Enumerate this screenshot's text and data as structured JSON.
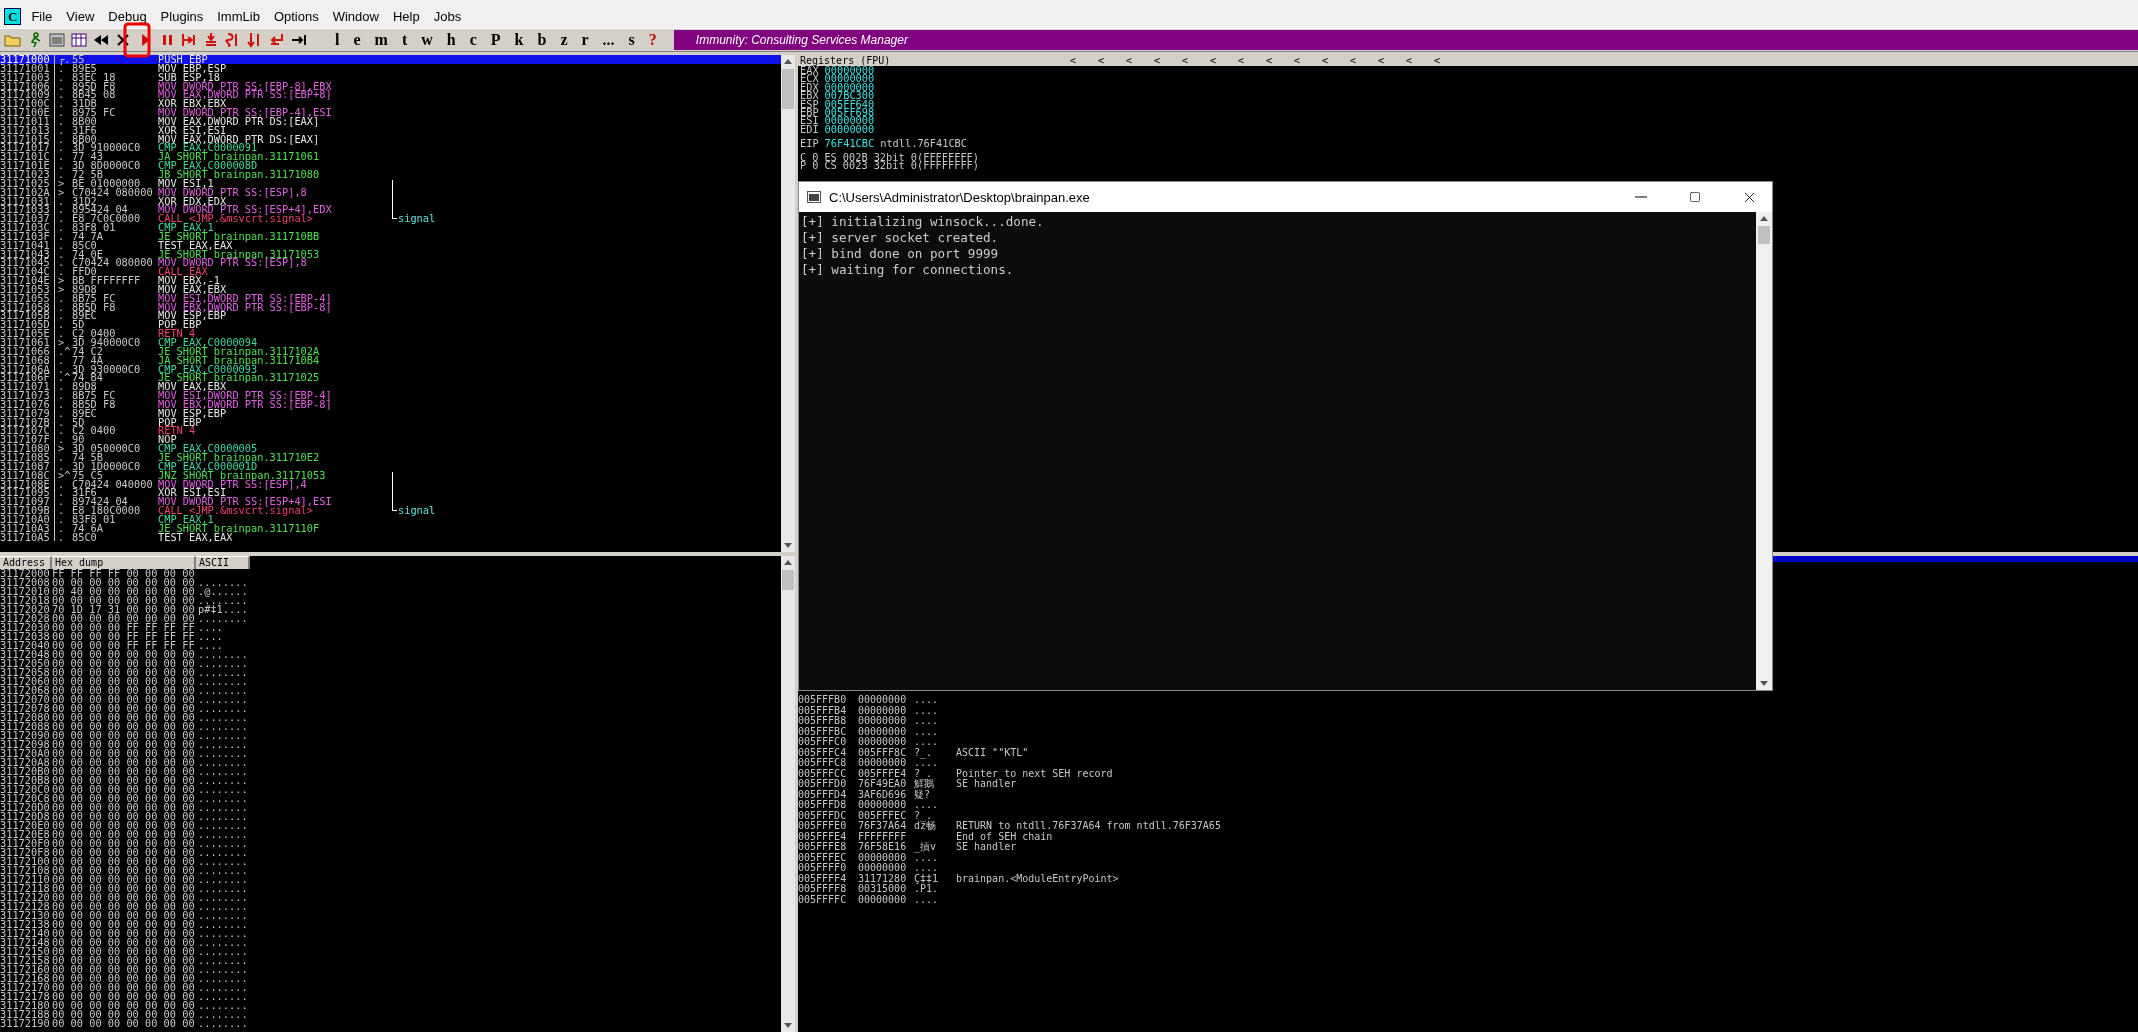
{
  "menu": {
    "app_icon": "C",
    "items": [
      "File",
      "View",
      "Debug",
      "Plugins",
      "ImmLib",
      "Options",
      "Window",
      "Help",
      "Jobs"
    ]
  },
  "toolbar": {
    "buttons": [
      {
        "label": "l",
        "kind": "window"
      },
      {
        "label": "e",
        "kind": "window"
      },
      {
        "label": "m",
        "kind": "window"
      },
      {
        "label": "t",
        "kind": "window"
      },
      {
        "label": "w",
        "kind": "window"
      },
      {
        "label": "h",
        "kind": "window"
      },
      {
        "label": "c",
        "kind": "window"
      },
      {
        "label": "P",
        "kind": "window"
      },
      {
        "label": "k",
        "kind": "window"
      },
      {
        "label": "b",
        "kind": "window"
      },
      {
        "label": "z",
        "kind": "window"
      },
      {
        "label": "r",
        "kind": "window"
      },
      {
        "label": "...",
        "kind": "window"
      },
      {
        "label": "s",
        "kind": "window"
      },
      {
        "label": "?",
        "kind": "help"
      }
    ],
    "banner": "Immunity: Consulting Services Manager"
  },
  "disassembly": [
    {
      "address": "31171000",
      "mark": "┌.",
      "hex": "55",
      "instruction": "PUSH EBP",
      "kind": "plain",
      "selected": true
    },
    {
      "address": "31171001",
      "mark": ".",
      "hex": "89E5",
      "instruction": "MOV EBP,ESP",
      "kind": "plain",
      "selected": false
    },
    {
      "address": "31171003",
      "mark": ".",
      "hex": "83EC 18",
      "instruction": "SUB ESP,18",
      "kind": "plain",
      "selected": false
    },
    {
      "address": "31171006",
      "mark": ".",
      "hex": "895D F8",
      "instruction": "MOV DWORD PTR SS:[EBP-8],EBX",
      "kind": "mem",
      "selected": false
    },
    {
      "address": "31171009",
      "mark": ".",
      "hex": "8B45 08",
      "instruction": "MOV EAX,DWORD PTR SS:[EBP+8]",
      "kind": "mem",
      "selected": false
    },
    {
      "address": "3117100C",
      "mark": ".",
      "hex": "31DB",
      "instruction": "XOR EBX,EBX",
      "kind": "plain",
      "selected": false
    },
    {
      "address": "3117100E",
      "mark": ".",
      "hex": "8975 FC",
      "instruction": "MOV DWORD PTR SS:[EBP-4],ESI",
      "kind": "mem",
      "selected": false
    },
    {
      "address": "31171011",
      "mark": ".",
      "hex": "8B00",
      "instruction": "MOV EAX,DWORD PTR DS:[EAX]",
      "kind": "plain",
      "selected": false
    },
    {
      "address": "31171013",
      "mark": ".",
      "hex": "31F6",
      "instruction": "XOR ESI,ESI",
      "kind": "plain",
      "selected": false
    },
    {
      "address": "31171015",
      "mark": ".",
      "hex": "8B00",
      "instruction": "MOV EAX,DWORD PTR DS:[EAX]",
      "kind": "plain",
      "selected": false
    },
    {
      "address": "31171017",
      "mark": ".",
      "hex": "3D 910000C0",
      "instruction": "CMP EAX,C0000091",
      "kind": "cmp",
      "selected": false
    },
    {
      "address": "3117101C",
      "mark": ".",
      "hex": "77 43",
      "instruction": "JA SHORT brainpan.31171061",
      "kind": "jump",
      "selected": false
    },
    {
      "address": "3117101E",
      "mark": ".",
      "hex": "3D 8D0000C0",
      "instruction": "CMP EAX,C000008D",
      "kind": "cmp",
      "selected": false
    },
    {
      "address": "31171023",
      "mark": ".",
      "hex": "72 5B",
      "instruction": "JB SHORT brainpan.31171080",
      "kind": "jump",
      "selected": false
    },
    {
      "address": "31171025",
      "mark": ">",
      "hex": "BE 01000000",
      "instruction": "MOV ESI,1",
      "kind": "plain",
      "selected": false
    },
    {
      "address": "3117102A",
      "mark": ">",
      "hex": "C70424 080000",
      "instruction": "MOV DWORD PTR SS:[ESP],8",
      "kind": "mem",
      "selected": false
    },
    {
      "address": "31171031",
      "mark": ".",
      "hex": "31D2",
      "instruction": "XOR EDX,EDX",
      "kind": "plain",
      "selected": false
    },
    {
      "address": "31171033",
      "mark": ".",
      "hex": "895424 04",
      "instruction": "MOV DWORD PTR SS:[ESP+4],EDX",
      "kind": "mem",
      "selected": false
    },
    {
      "address": "31171037",
      "mark": ".",
      "hex": "E8 7C0C0000",
      "instruction": "CALL <JMP.&msvcrt.signal>",
      "kind": "call",
      "comment": "signal",
      "selected": false
    },
    {
      "address": "3117103C",
      "mark": ".",
      "hex": "83F8 01",
      "instruction": "CMP EAX,1",
      "kind": "cmp",
      "selected": false
    },
    {
      "address": "3117103F",
      "mark": ".",
      "hex": "74 7A",
      "instruction": "JE SHORT brainpan.311710BB",
      "kind": "jump",
      "selected": false
    },
    {
      "address": "31171041",
      "mark": ".",
      "hex": "85C0",
      "instruction": "TEST EAX,EAX",
      "kind": "plain",
      "selected": false
    },
    {
      "address": "31171043",
      "mark": ".",
      "hex": "74 0E",
      "instruction": "JE SHORT brainpan.31171053",
      "kind": "jump",
      "selected": false
    },
    {
      "address": "31171045",
      "mark": ".",
      "hex": "C70424 080000",
      "instruction": "MOV DWORD PTR SS:[ESP],8",
      "kind": "mem",
      "selected": false
    },
    {
      "address": "3117104C",
      "mark": ".",
      "hex": "FFD0",
      "instruction": "CALL EAX",
      "kind": "call",
      "selected": false
    },
    {
      "address": "3117104E",
      "mark": ">",
      "hex": "BB FFFFFFFF",
      "instruction": "MOV EBX,-1",
      "kind": "plain",
      "selected": false
    },
    {
      "address": "31171053",
      "mark": ">",
      "hex": "89D8",
      "instruction": "MOV EAX,EBX",
      "kind": "plain",
      "selected": false
    },
    {
      "address": "31171055",
      "mark": ".",
      "hex": "8B75 FC",
      "instruction": "MOV ESI,DWORD PTR SS:[EBP-4]",
      "kind": "mem",
      "selected": false
    },
    {
      "address": "31171058",
      "mark": ".",
      "hex": "8B5D F8",
      "instruction": "MOV EBX,DWORD PTR SS:[EBP-8]",
      "kind": "mem",
      "selected": false
    },
    {
      "address": "3117105B",
      "mark": ".",
      "hex": "89EC",
      "instruction": "MOV ESP,EBP",
      "kind": "plain",
      "selected": false
    },
    {
      "address": "3117105D",
      "mark": ".",
      "hex": "5D",
      "instruction": "POP EBP",
      "kind": "plain",
      "selected": false
    },
    {
      "address": "3117105E",
      "mark": ".",
      "hex": "C2 0400",
      "instruction": "RETN 4",
      "kind": "call",
      "selected": false
    },
    {
      "address": "31171061",
      "mark": ">",
      "hex": "3D 940000C0",
      "instruction": "CMP EAX,C0000094",
      "kind": "cmp",
      "selected": false
    },
    {
      "address": "31171066",
      "mark": ".^",
      "hex": "74 C2",
      "instruction": "JE SHORT brainpan.3117102A",
      "kind": "jump",
      "selected": false
    },
    {
      "address": "31171068",
      "mark": ".",
      "hex": "77 4A",
      "instruction": "JA SHORT brainpan.311710B4",
      "kind": "jump",
      "selected": false
    },
    {
      "address": "3117106A",
      "mark": ".",
      "hex": "3D 930000C0",
      "instruction": "CMP EAX,C0000093",
      "kind": "cmp",
      "selected": false
    },
    {
      "address": "3117106F",
      "mark": ".^",
      "hex": "74 B4",
      "instruction": "JE SHORT brainpan.31171025",
      "kind": "jump",
      "selected": false
    },
    {
      "address": "31171071",
      "mark": ".",
      "hex": "89D8",
      "instruction": "MOV EAX,EBX",
      "kind": "plain",
      "selected": false
    },
    {
      "address": "31171073",
      "mark": ".",
      "hex": "8B75 FC",
      "instruction": "MOV ESI,DWORD PTR SS:[EBP-4]",
      "kind": "mem",
      "selected": false
    },
    {
      "address": "31171076",
      "mark": ".",
      "hex": "8B5D F8",
      "instruction": "MOV EBX,DWORD PTR SS:[EBP-8]",
      "kind": "mem",
      "selected": false
    },
    {
      "address": "31171079",
      "mark": ".",
      "hex": "89EC",
      "instruction": "MOV ESP,EBP",
      "kind": "plain",
      "selected": false
    },
    {
      "address": "3117107B",
      "mark": ".",
      "hex": "5D",
      "instruction": "POP EBP",
      "kind": "plain",
      "selected": false
    },
    {
      "address": "3117107C",
      "mark": ".",
      "hex": "C2 0400",
      "instruction": "RETN 4",
      "kind": "call",
      "selected": false
    },
    {
      "address": "3117107F",
      "mark": ".",
      "hex": "90",
      "instruction": "NOP",
      "kind": "plain",
      "selected": false
    },
    {
      "address": "31171080",
      "mark": ">",
      "hex": "3D 050000C0",
      "instruction": "CMP EAX,C0000005",
      "kind": "cmp",
      "selected": false
    },
    {
      "address": "31171085",
      "mark": ".",
      "hex": "74 5B",
      "instruction": "JE SHORT brainpan.311710E2",
      "kind": "jump",
      "selected": false
    },
    {
      "address": "31171087",
      "mark": ".",
      "hex": "3D 1D0000C0",
      "instruction": "CMP EAX,C000001D",
      "kind": "cmp",
      "selected": false
    },
    {
      "address": "3117108C",
      "mark": ">^",
      "hex": "75 C5",
      "instruction": "JNZ SHORT brainpan.31171053",
      "kind": "jump",
      "selected": false
    },
    {
      "address": "3117108E",
      "mark": ".",
      "hex": "C70424 040000",
      "instruction": "MOV DWORD PTR SS:[ESP],4",
      "kind": "mem",
      "selected": false
    },
    {
      "address": "31171095",
      "mark": ".",
      "hex": "31F6",
      "instruction": "XOR ESI,ESI",
      "kind": "plain",
      "selected": false
    },
    {
      "address": "31171097",
      "mark": ".",
      "hex": "897424 04",
      "instruction": "MOV DWORD PTR SS:[ESP+4],ESI",
      "kind": "mem",
      "selected": false
    },
    {
      "address": "3117109B",
      "mark": ".",
      "hex": "E8 180C0000",
      "instruction": "CALL <JMP.&msvcrt.signal>",
      "kind": "call",
      "comment": "signal",
      "selected": false
    },
    {
      "address": "311710A0",
      "mark": ".",
      "hex": "83F8 01",
      "instruction": "CMP EAX,1",
      "kind": "cmp",
      "selected": false
    },
    {
      "address": "311710A3",
      "mark": ".",
      "hex": "74 6A",
      "instruction": "JE SHORT brainpan.3117110F",
      "kind": "jump",
      "selected": false
    },
    {
      "address": "311710A5",
      "mark": ".",
      "hex": "85C0",
      "instruction": "TEST EAX,EAX",
      "kind": "plain",
      "selected": false
    }
  ],
  "registers": {
    "title": "Registers (FPU)",
    "arrows": [
      "<",
      "<",
      "<",
      "<",
      "<",
      "<",
      "<",
      "<",
      "<",
      "<",
      "<",
      "<",
      "<",
      "<"
    ],
    "rows": [
      {
        "name": "EAX",
        "value": "00000000"
      },
      {
        "name": "ECX",
        "value": "00000000"
      },
      {
        "name": "EDX",
        "value": "00000000"
      },
      {
        "name": "EBX",
        "value": "007BC300"
      },
      {
        "name": "ESP",
        "value": "005FF640"
      },
      {
        "name": "EBP",
        "value": "005FF698"
      },
      {
        "name": "ESI",
        "value": "00000000"
      },
      {
        "name": "EDI",
        "value": "00000000"
      }
    ],
    "eip": {
      "name": "EIP",
      "value": "76F41CBC",
      "comment": "ntdll.76F41CBC"
    },
    "flags": [
      {
        "flag": "C",
        "bit": "0",
        "segment": "ES",
        "selector": "002B",
        "info": "32bit 0(FFFFFFFF)"
      },
      {
        "flag": "P",
        "bit": "0",
        "segment": "CS",
        "selector": "0023",
        "info": "32bit 0(FFFFFFFF)"
      }
    ]
  },
  "dump": {
    "columns": [
      "Address",
      "Hex dump",
      "ASCII"
    ],
    "rows": [
      {
        "address": "31172000",
        "hex": "FF FF FF FF 00 00 00 00"
      },
      {
        "address": "31172008",
        "hex": "00 00 00 00 00 00 00 00",
        "ascii": "........"
      },
      {
        "address": "31172010",
        "hex": "00 40 00 00 00 00 00 00",
        "ascii": ".@......"
      },
      {
        "address": "31172018",
        "hex": "00 00 00 00 00 00 00 00",
        "ascii": "........"
      },
      {
        "address": "31172020",
        "hex": "70 1D 17 31 00 00 00 00",
        "ascii": "p#‡1...."
      },
      {
        "address": "31172028",
        "hex": "00 00 00 00 00 00 00 00",
        "ascii": "........"
      },
      {
        "address": "31172030",
        "hex": "00 00 00 00 FF FF FF FF",
        "ascii": "...."
      },
      {
        "address": "31172038",
        "hex": "00 00 00 00 FF FF FF FF",
        "ascii": "...."
      },
      {
        "address": "31172040",
        "hex": "00 00 00 00 FF FF FF FF",
        "ascii": "...."
      },
      {
        "address": "31172048",
        "hex": "00 00 00 00 00 00 00 00",
        "ascii": "........"
      },
      {
        "address": "31172050",
        "hex": "00 00 00 00 00 00 00 00",
        "ascii": "........"
      },
      {
        "address": "31172058",
        "hex": "00 00 00 00 00 00 00 00",
        "ascii": "........"
      },
      {
        "address": "31172060",
        "hex": "00 00 00 00 00 00 00 00",
        "ascii": "........"
      },
      {
        "address": "31172068",
        "hex": "00 00 00 00 00 00 00 00",
        "ascii": "........"
      },
      {
        "address": "31172070",
        "hex": "00 00 00 00 00 00 00 00",
        "ascii": "........"
      },
      {
        "address": "31172078",
        "hex": "00 00 00 00 00 00 00 00",
        "ascii": "........"
      },
      {
        "address": "31172080",
        "hex": "00 00 00 00 00 00 00 00",
        "ascii": "........"
      },
      {
        "address": "31172088",
        "hex": "00 00 00 00 00 00 00 00",
        "ascii": "........"
      },
      {
        "address": "31172090",
        "hex": "00 00 00 00 00 00 00 00",
        "ascii": "........"
      },
      {
        "address": "31172098",
        "hex": "00 00 00 00 00 00 00 00",
        "ascii": "........"
      },
      {
        "address": "311720A0",
        "hex": "00 00 00 00 00 00 00 00",
        "ascii": "........"
      },
      {
        "address": "311720A8",
        "hex": "00 00 00 00 00 00 00 00",
        "ascii": "........"
      },
      {
        "address": "311720B0",
        "hex": "00 00 00 00 00 00 00 00",
        "ascii": "........"
      },
      {
        "address": "311720B8",
        "hex": "00 00 00 00 00 00 00 00",
        "ascii": "........"
      },
      {
        "address": "311720C0",
        "hex": "00 00 00 00 00 00 00 00",
        "ascii": "........"
      },
      {
        "address": "311720C8",
        "hex": "00 00 00 00 00 00 00 00",
        "ascii": "........"
      },
      {
        "address": "311720D0",
        "hex": "00 00 00 00 00 00 00 00",
        "ascii": "........"
      },
      {
        "address": "311720D8",
        "hex": "00 00 00 00 00 00 00 00",
        "ascii": "........"
      },
      {
        "address": "311720E0",
        "hex": "00 00 00 00 00 00 00 00",
        "ascii": "........"
      },
      {
        "address": "311720E8",
        "hex": "00 00 00 00 00 00 00 00",
        "ascii": "........"
      },
      {
        "address": "311720F0",
        "hex": "00 00 00 00 00 00 00 00",
        "ascii": "........"
      },
      {
        "address": "311720F8",
        "hex": "00 00 00 00 00 00 00 00",
        "ascii": "........"
      },
      {
        "address": "31172100",
        "hex": "00 00 00 00 00 00 00 00",
        "ascii": "........"
      },
      {
        "address": "31172108",
        "hex": "00 00 00 00 00 00 00 00",
        "ascii": "........"
      },
      {
        "address": "31172110",
        "hex": "00 00 00 00 00 00 00 00",
        "ascii": "........"
      },
      {
        "address": "31172118",
        "hex": "00 00 00 00 00 00 00 00",
        "ascii": "........"
      },
      {
        "address": "31172120",
        "hex": "00 00 00 00 00 00 00 00",
        "ascii": "........"
      },
      {
        "address": "31172128",
        "hex": "00 00 00 00 00 00 00 00",
        "ascii": "........"
      },
      {
        "address": "31172130",
        "hex": "00 00 00 00 00 00 00 00",
        "ascii": "........"
      },
      {
        "address": "31172138",
        "hex": "00 00 00 00 00 00 00 00",
        "ascii": "........"
      },
      {
        "address": "31172140",
        "hex": "00 00 00 00 00 00 00 00",
        "ascii": "........"
      },
      {
        "address": "31172148",
        "hex": "00 00 00 00 00 00 00 00",
        "ascii": "........"
      },
      {
        "address": "31172150",
        "hex": "00 00 00 00 00 00 00 00",
        "ascii": "........"
      },
      {
        "address": "31172158",
        "hex": "00 00 00 00 00 00 00 00",
        "ascii": "........"
      },
      {
        "address": "31172160",
        "hex": "00 00 00 00 00 00 00 00",
        "ascii": "........"
      },
      {
        "address": "31172168",
        "hex": "00 00 00 00 00 00 00 00",
        "ascii": "........"
      },
      {
        "address": "31172170",
        "hex": "00 00 00 00 00 00 00 00",
        "ascii": "........"
      },
      {
        "address": "31172178",
        "hex": "00 00 00 00 00 00 00 00",
        "ascii": "........"
      },
      {
        "address": "31172180",
        "hex": "00 00 00 00 00 00 00 00",
        "ascii": "........"
      },
      {
        "address": "31172188",
        "hex": "00 00 00 00 00 00 00 00",
        "ascii": "........"
      },
      {
        "address": "31172190",
        "hex": "00 00 00 00 00 00 00 00",
        "ascii": "........"
      }
    ]
  },
  "stack": [
    {
      "address": "005FFFB0",
      "value": "00000000",
      "ascii": "...."
    },
    {
      "address": "005FFFB4",
      "value": "00000000",
      "ascii": "...."
    },
    {
      "address": "005FFFB8",
      "value": "00000000",
      "ascii": "...."
    },
    {
      "address": "005FFFBC",
      "value": "00000000",
      "ascii": "...."
    },
    {
      "address": "005FFFC0",
      "value": "00000000",
      "ascii": "...."
    },
    {
      "address": "005FFFC4",
      "value": "005FFF8C",
      "ascii": "?_.",
      "comment": "ASCII \"\"KTL\""
    },
    {
      "address": "005FFFC8",
      "value": "00000000",
      "ascii": "...."
    },
    {
      "address": "005FFFCC",
      "value": "005FFFE4",
      "ascii": "?_.",
      "comment": "Pointer to next SEH record"
    },
    {
      "address": "005FFFD0",
      "value": "76F49EA0",
      "ascii": "鮮鵝",
      "comment": "SE handler"
    },
    {
      "address": "005FFFD4",
      "value": "3AF6D696",
      "ascii": "疑?"
    },
    {
      "address": "005FFFD8",
      "value": "00000000",
      "ascii": "...."
    },
    {
      "address": "005FFFDC",
      "value": "005FFFEC",
      "ascii": "?_."
    },
    {
      "address": "005FFFE0",
      "value": "76F37A64",
      "ascii": "dz畅",
      "comment": "RETURN to ntdll.76F37A64 from ntdll.76F37A65"
    },
    {
      "address": "005FFFE4",
      "value": "FFFFFFFF",
      "comment": "End of SEH chain"
    },
    {
      "address": "005FFFE8",
      "value": "76F58E16",
      "ascii": "_摃v",
      "comment": "SE handler"
    },
    {
      "address": "005FFFEC",
      "value": "00000000",
      "ascii": "...."
    },
    {
      "address": "005FFFF0",
      "value": "00000000",
      "ascii": "...."
    },
    {
      "address": "005FFFF4",
      "value": "31171280",
      "ascii": "Ç‡‡1",
      "comment": "brainpan.<ModuleEntryPoint>"
    },
    {
      "address": "005FFFF8",
      "value": "00315000",
      "ascii": ".P1."
    },
    {
      "address": "005FFFFC",
      "value": "00000000",
      "ascii": "...."
    }
  ],
  "console": {
    "title": "C:\\Users\\Administrator\\Desktop\\brainpan.exe",
    "lines": [
      "[+] initializing winsock...done.",
      "[+] server socket created.",
      "[+] bind done on port 9999",
      "[+] waiting for connections."
    ]
  }
}
